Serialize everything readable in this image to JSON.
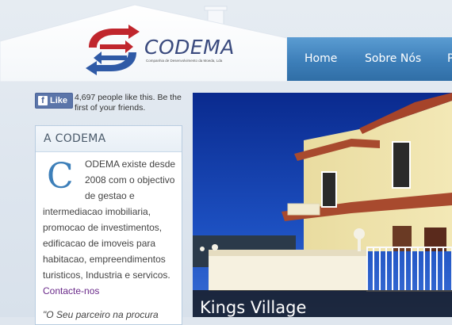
{
  "brand": {
    "name": "CODEMA",
    "tagline": "Companhia de Desenvolvimento da Moeda, Lda"
  },
  "nav": {
    "items": [
      "Home",
      "Sobre Nós",
      "P"
    ]
  },
  "facebook": {
    "like_label": "Like",
    "count_text_line1": "4,697 people like this. Be the",
    "count_text_line2": "first of your friends."
  },
  "sidebar": {
    "title": "A CODEMA",
    "dropcap": "C",
    "lines": [
      "ODEMA existe desde",
      "2008 com o objectivo",
      "de gestao e",
      "intermediacao imobiliaria,",
      "promocao de investimentos,",
      "edificacao de imoveis para",
      "habitacao, empreendimentos",
      "turisticos,  Industria e servicos."
    ],
    "contact_link": "Contacte-nos",
    "quote": "\"O Seu parceiro na procura"
  },
  "hero": {
    "caption": "Kings Village"
  },
  "colors": {
    "nav_blue": "#3d7fb9",
    "logo_red": "#c0262d",
    "logo_blue": "#2f5aa6",
    "link_purple": "#6a2a8a"
  }
}
